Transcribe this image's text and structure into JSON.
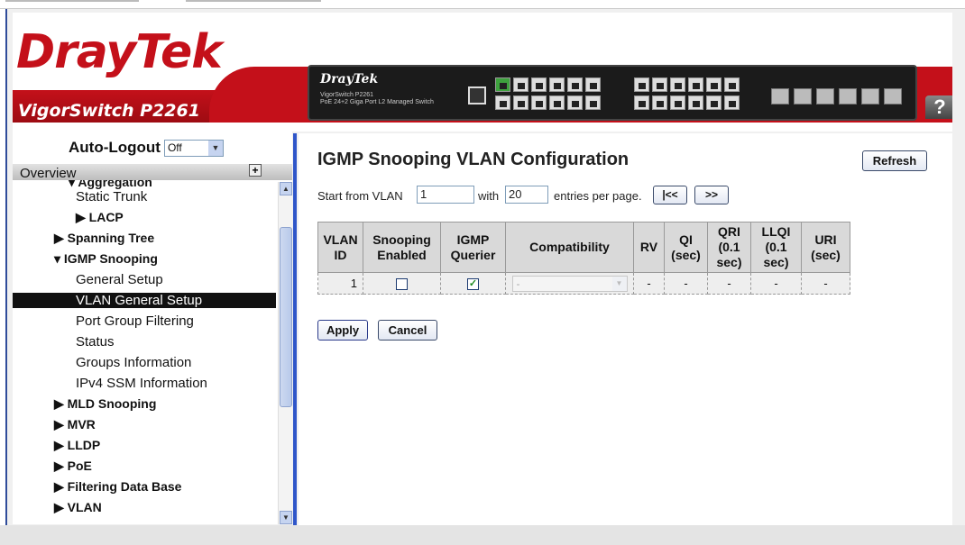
{
  "header": {
    "logo_text": "DrayTek",
    "model": "VigorSwitch P2261",
    "device_brand": "DrayTek",
    "device_sub1": "VigorSwitch P2261",
    "device_sub2": "PoE 24+2 Giga Port L2 Managed Switch",
    "help_label": "?",
    "brand_color": "#c4101a"
  },
  "sidebar": {
    "autologout_label": "Auto-Logout",
    "autologout_value": "Off",
    "overview_label": "Overview",
    "items": [
      {
        "label": "▾ Aggregation",
        "bold": true
      },
      {
        "label": "Static Trunk"
      },
      {
        "label": "▶ LACP",
        "bold": true
      },
      {
        "label": "▶ Spanning Tree",
        "bold": true
      },
      {
        "label": "▾ IGMP Snooping",
        "bold": true
      },
      {
        "label": "General Setup"
      },
      {
        "label": "VLAN General Setup",
        "selected": true
      },
      {
        "label": "Port Group Filtering"
      },
      {
        "label": "Status"
      },
      {
        "label": "Groups Information"
      },
      {
        "label": "IPv4 SSM Information"
      },
      {
        "label": "▶ MLD Snooping",
        "bold": true
      },
      {
        "label": "▶ MVR",
        "bold": true
      },
      {
        "label": "▶ LLDP",
        "bold": true
      },
      {
        "label": "▶ PoE",
        "bold": true
      },
      {
        "label": "▶ Filtering Data Base",
        "bold": true
      },
      {
        "label": "▶ VLAN",
        "bold": true
      }
    ]
  },
  "main": {
    "title": "IGMP Snooping VLAN Configuration",
    "refresh_label": "Refresh",
    "start_label": "Start from VLAN",
    "start_value": "1",
    "with_label": "with",
    "with_value": "20",
    "per_page_label": "entries per page.",
    "first_label": "|<<",
    "next_label": ">>",
    "table": {
      "headers": [
        "VLAN\nID",
        "Snooping\nEnabled",
        "IGMP\nQuerier",
        "Compatibility",
        "RV",
        "QI\n(sec)",
        "QRI\n(0.1\nsec)",
        "LLQI\n(0.1\nsec)",
        "URI\n(sec)"
      ],
      "rows": [
        {
          "vlan_id": "1",
          "snooping_enabled": false,
          "igmp_querier": true,
          "compatibility": "-",
          "rv": "-",
          "qi": "-",
          "qri": "-",
          "llqi": "-",
          "uri": "-"
        }
      ]
    },
    "apply_label": "Apply",
    "cancel_label": "Cancel"
  }
}
